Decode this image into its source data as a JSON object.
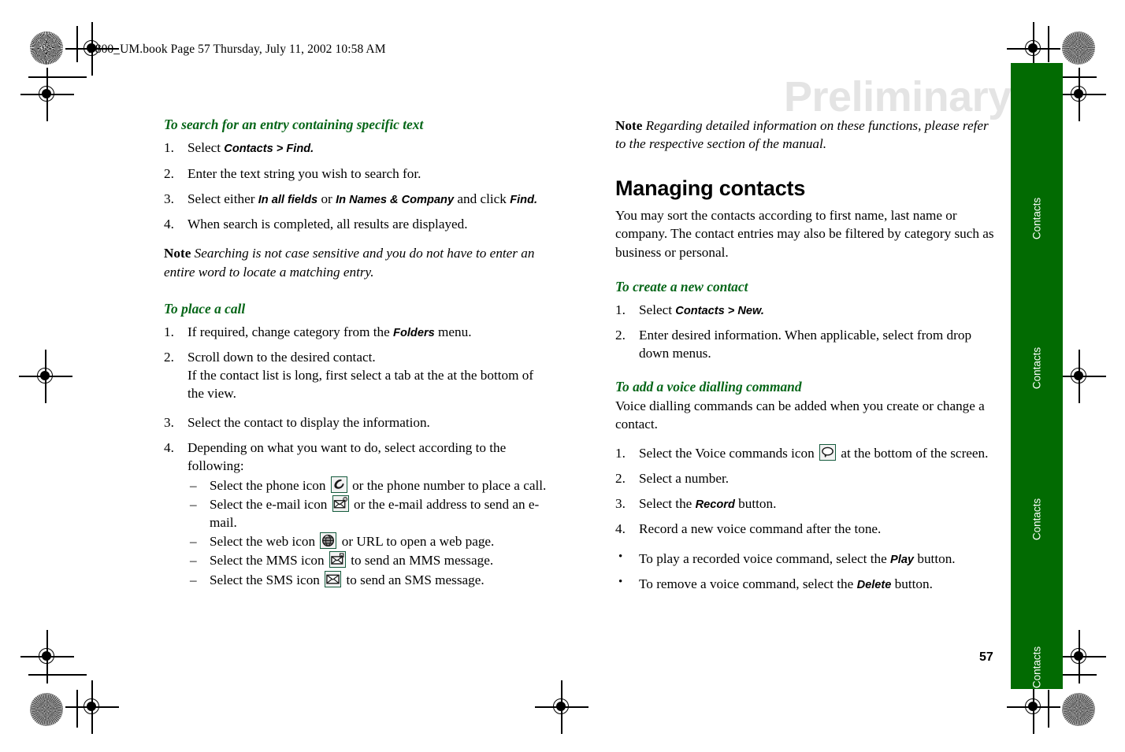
{
  "page": {
    "file_header": "P800_UM.book  Page 57  Thursday, July 11, 2002  10:58 AM",
    "watermark": "Preliminary",
    "page_number": "57",
    "tab_label_1": "Contacts",
    "tab_label_2": "Contacts",
    "tab_label_3": "Contacts",
    "tab_label_4": "Contacts",
    "colors": {
      "tab_green": "#026b02",
      "heading_green": "#066618",
      "icon_border": "#145a3c",
      "watermark_grey": "#e4e4e4"
    }
  },
  "left_column": {
    "search_heading": "To search for an entry containing specific text",
    "search_steps": [
      {
        "num": "1.",
        "pre": "Select ",
        "ui": "Contacts > Find.",
        "post": ""
      },
      {
        "num": "2.",
        "pre": "Enter the text string you wish to search for.",
        "ui": "",
        "post": ""
      },
      {
        "num": "3.",
        "pre": "Select either ",
        "ui": "In all fields",
        "mid": " or ",
        "ui2": "In Names & Company",
        "mid2": " and click ",
        "ui3": "Find.",
        "post": ""
      },
      {
        "num": "4.",
        "pre": "When search is completed, all results are displayed.",
        "ui": "",
        "post": ""
      }
    ],
    "search_note_label": "Note",
    "search_note_text": " Searching is not case sensitive and you do not have to enter an entire word to locate a matching entry.",
    "call_heading": "To place a call",
    "call_step_1_pre": "If required, change category from the ",
    "call_step_1_ui": "Folders",
    "call_step_1_post": " menu.",
    "call_step_2_line1": "Scroll down to the desired contact.",
    "call_step_2_line2": "If the contact list is long, first select a tab at the at the bottom of the view.",
    "call_step_3": "Select the contact to display the information.",
    "call_step_4": "Depending on what you want to do, select according to the following:",
    "icon_items": [
      {
        "dash": "–",
        "pre": "Select the phone icon ",
        "icon": "phone-icon",
        "post": " or the phone number to place a call."
      },
      {
        "dash": "–",
        "pre": "Select the e-mail icon ",
        "icon": "email-icon",
        "post": " or the e-mail address to send an e-mail."
      },
      {
        "dash": "–",
        "pre": "Select the web icon ",
        "icon": "web-globe-icon",
        "post": " or URL to open a web page."
      },
      {
        "dash": "–",
        "pre": "Select the MMS icon ",
        "icon": "mms-icon",
        "post": " to send an MMS message."
      },
      {
        "dash": "–",
        "pre": "Select the SMS icon ",
        "icon": "sms-icon",
        "post": " to send an SMS message."
      }
    ]
  },
  "right_column": {
    "top_note_label": "Note",
    "top_note_text": " Regarding detailed information on these functions, please refer to the respective section of the manual.",
    "section_heading": "Managing contacts",
    "section_intro": "You may sort the contacts according to first name, last name or company. The contact entries may also be filtered by category such as business or personal.",
    "create_heading": "To create a new contact",
    "create_step_1_pre": "Select ",
    "create_step_1_ui": "Contacts > New.",
    "create_step_2": "Enter desired information. When applicable, select from drop down menus.",
    "voice_heading": "To add a voice dialling command",
    "voice_intro": "Voice dialling commands can be added when you create or change a contact.",
    "voice_step_1_pre": "Select the Voice commands icon ",
    "voice_step_1_icon": "voice-bubble-icon",
    "voice_step_1_post": " at the bottom of the screen.",
    "voice_step_2": "Select a number.",
    "voice_step_3_pre": "Select the ",
    "voice_step_3_ui": "Record",
    "voice_step_3_post": " button.",
    "voice_step_4": "Record a new voice command after the tone.",
    "bullets": [
      {
        "bul": "•",
        "pre": "To play a recorded voice command, select the ",
        "ui": "Play",
        "post": " button."
      },
      {
        "bul": "•",
        "pre": "To remove a voice command, select the ",
        "ui": "Delete",
        "post": " button."
      }
    ],
    "step_nums": {
      "one": "1.",
      "two": "2.",
      "three": "3.",
      "four": "4."
    }
  }
}
